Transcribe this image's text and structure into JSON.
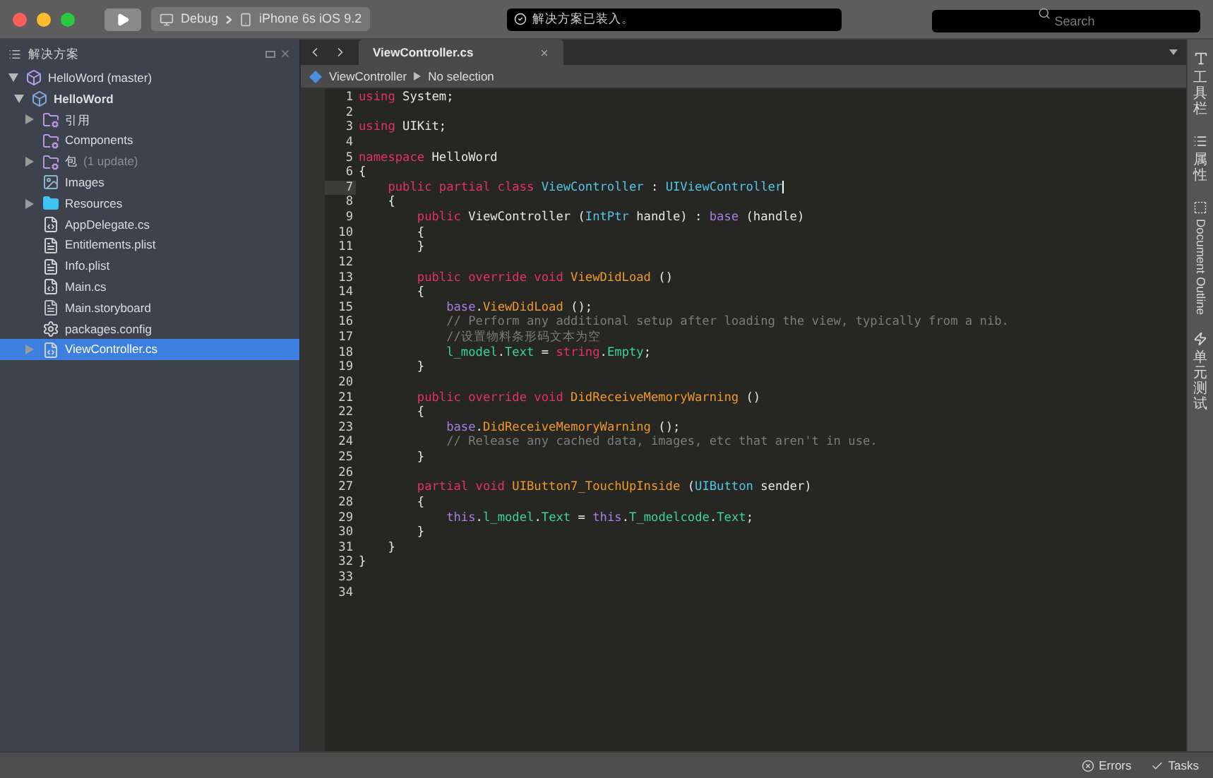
{
  "toolbar": {
    "config": "Debug",
    "device": "iPhone 6s iOS 9.2",
    "status": "解决方案已装入。",
    "search": {
      "placeholder": "Search"
    }
  },
  "solution_pad": {
    "title": "解决方案",
    "tree": [
      {
        "label": "HelloWord (master)",
        "kind": "solution",
        "expanded": true,
        "selected": false,
        "children": [
          {
            "label": "HelloWord",
            "kind": "project",
            "expanded": true,
            "selected": false,
            "children": [
              {
                "label": "引用",
                "kind": "folder-ref",
                "expanded": false,
                "selected": false
              },
              {
                "label": "Components",
                "kind": "folder-ref",
                "selected": false
              },
              {
                "label": "包",
                "note": "(1 update)",
                "kind": "folder-ref",
                "expanded": false,
                "selected": false
              },
              {
                "label": "Images",
                "kind": "folder-image",
                "selected": false
              },
              {
                "label": "Resources",
                "kind": "folder",
                "expanded": false,
                "selected": false
              },
              {
                "label": "AppDelegate.cs",
                "kind": "code",
                "selected": false
              },
              {
                "label": "Entitlements.plist",
                "kind": "file",
                "selected": false
              },
              {
                "label": "Info.plist",
                "kind": "file",
                "selected": false
              },
              {
                "label": "Main.cs",
                "kind": "code",
                "selected": false
              },
              {
                "label": "Main.storyboard",
                "kind": "storyboard",
                "selected": false
              },
              {
                "label": "packages.config",
                "kind": "config",
                "selected": false
              },
              {
                "label": "ViewController.cs",
                "kind": "code",
                "expanded": false,
                "selected": true
              }
            ]
          }
        ]
      }
    ]
  },
  "editor": {
    "tab": "ViewController.cs",
    "breadcrumb": [
      "ViewController",
      "No selection"
    ],
    "lines": [
      {
        "number": "1",
        "current": false,
        "tokens": [
          {
            "text": "using",
            "kind": "keyword"
          },
          {
            "text": " System;",
            "kind": "plain"
          }
        ]
      },
      {
        "number": "2",
        "current": false
      },
      {
        "number": "3",
        "current": false,
        "tokens": [
          {
            "text": "using",
            "kind": "keyword"
          },
          {
            "text": " UIKit;",
            "kind": "plain"
          }
        ]
      },
      {
        "number": "4",
        "current": false
      },
      {
        "number": "5",
        "current": false,
        "tokens": [
          {
            "text": "namespace",
            "kind": "keyword"
          },
          {
            "text": " HelloWord",
            "kind": "plain"
          }
        ]
      },
      {
        "number": "6",
        "current": false,
        "tokens": [
          {
            "text": "{",
            "kind": "plain"
          }
        ]
      },
      {
        "number": "7",
        "current": true,
        "tokens": [
          {
            "text": "    public partial class",
            "kind": "keyword"
          },
          {
            "text": " ViewController",
            "kind": "type"
          },
          {
            "text": " : ",
            "kind": "plain"
          },
          {
            "text": "UIViewController",
            "kind": "type"
          }
        ]
      },
      {
        "number": "8",
        "current": false,
        "tokens": [
          {
            "text": "    {",
            "kind": "plain"
          }
        ]
      },
      {
        "number": "9",
        "current": false,
        "tokens": [
          {
            "text": "        public",
            "kind": "keyword"
          },
          {
            "text": " ViewController (",
            "kind": "plain"
          },
          {
            "text": "IntPtr",
            "kind": "type"
          },
          {
            "text": " handle) : ",
            "kind": "plain"
          },
          {
            "text": "base",
            "kind": "self"
          },
          {
            "text": " (handle)",
            "kind": "plain"
          }
        ]
      },
      {
        "number": "10",
        "current": false,
        "tokens": [
          {
            "text": "        {",
            "kind": "plain"
          }
        ]
      },
      {
        "number": "11",
        "current": false,
        "tokens": [
          {
            "text": "        }",
            "kind": "plain"
          }
        ]
      },
      {
        "number": "12",
        "current": false
      },
      {
        "number": "13",
        "current": false,
        "tokens": [
          {
            "text": "        public override void",
            "kind": "keyword"
          },
          {
            "text": " ViewDidLoad",
            "kind": "method"
          },
          {
            "text": " ()",
            "kind": "plain"
          }
        ]
      },
      {
        "number": "14",
        "current": false,
        "tokens": [
          {
            "text": "        {",
            "kind": "plain"
          }
        ]
      },
      {
        "number": "15",
        "current": false,
        "tokens": [
          {
            "text": "            base",
            "kind": "self"
          },
          {
            "text": ".",
            "kind": "plain"
          },
          {
            "text": "ViewDidLoad",
            "kind": "method"
          },
          {
            "text": " ();",
            "kind": "plain"
          }
        ]
      },
      {
        "number": "16",
        "current": false,
        "tokens": [
          {
            "text": "            // Perform any additional setup after loading the view, typically from a nib.",
            "kind": "comment"
          }
        ]
      },
      {
        "number": "17",
        "current": false,
        "tokens": [
          {
            "text": "            //设置物料条形码文本为空",
            "kind": "comment"
          }
        ]
      },
      {
        "number": "18",
        "current": false,
        "tokens": [
          {
            "text": "            l_model",
            "kind": "property"
          },
          {
            "text": ".",
            "kind": "plain"
          },
          {
            "text": "Text",
            "kind": "property"
          },
          {
            "text": " = ",
            "kind": "plain"
          },
          {
            "text": "string",
            "kind": "keyword"
          },
          {
            "text": ".",
            "kind": "plain"
          },
          {
            "text": "Empty",
            "kind": "property"
          },
          {
            "text": ";",
            "kind": "plain"
          }
        ]
      },
      {
        "number": "19",
        "current": false,
        "tokens": [
          {
            "text": "        }",
            "kind": "plain"
          }
        ]
      },
      {
        "number": "20",
        "current": false
      },
      {
        "number": "21",
        "current": false,
        "tokens": [
          {
            "text": "        public override void",
            "kind": "keyword"
          },
          {
            "text": " DidReceiveMemoryWarning",
            "kind": "method"
          },
          {
            "text": " ()",
            "kind": "plain"
          }
        ]
      },
      {
        "number": "22",
        "current": false,
        "tokens": [
          {
            "text": "        {",
            "kind": "plain"
          }
        ]
      },
      {
        "number": "23",
        "current": false,
        "tokens": [
          {
            "text": "            base",
            "kind": "self"
          },
          {
            "text": ".",
            "kind": "plain"
          },
          {
            "text": "DidReceiveMemoryWarning",
            "kind": "method"
          },
          {
            "text": " ();",
            "kind": "plain"
          }
        ]
      },
      {
        "number": "24",
        "current": false,
        "tokens": [
          {
            "text": "            // Release any cached data, images, etc that aren't in use.",
            "kind": "comment"
          }
        ]
      },
      {
        "number": "25",
        "current": false,
        "tokens": [
          {
            "text": "        }",
            "kind": "plain"
          }
        ]
      },
      {
        "number": "26",
        "current": false
      },
      {
        "number": "27",
        "current": false,
        "tokens": [
          {
            "text": "        partial void",
            "kind": "keyword"
          },
          {
            "text": " UIButton7_TouchUpInside",
            "kind": "method"
          },
          {
            "text": " (",
            "kind": "plain"
          },
          {
            "text": "UIButton",
            "kind": "type"
          },
          {
            "text": " sender)",
            "kind": "plain"
          }
        ]
      },
      {
        "number": "28",
        "current": false,
        "tokens": [
          {
            "text": "        {",
            "kind": "plain"
          }
        ]
      },
      {
        "number": "29",
        "current": false,
        "tokens": [
          {
            "text": "            this",
            "kind": "self"
          },
          {
            "text": ".",
            "kind": "plain"
          },
          {
            "text": "l_model",
            "kind": "property"
          },
          {
            "text": ".",
            "kind": "plain"
          },
          {
            "text": "Text",
            "kind": "property"
          },
          {
            "text": " = ",
            "kind": "plain"
          },
          {
            "text": "this",
            "kind": "self"
          },
          {
            "text": ".",
            "kind": "plain"
          },
          {
            "text": "T_modelcode",
            "kind": "property"
          },
          {
            "text": ".",
            "kind": "plain"
          },
          {
            "text": "Text",
            "kind": "property"
          },
          {
            "text": ";",
            "kind": "plain"
          }
        ]
      },
      {
        "number": "30",
        "current": false,
        "tokens": [
          {
            "text": "        }",
            "kind": "plain"
          }
        ]
      },
      {
        "number": "31",
        "current": false,
        "tokens": [
          {
            "text": "    }",
            "kind": "plain"
          }
        ]
      },
      {
        "number": "32",
        "current": false,
        "tokens": [
          {
            "text": "}",
            "kind": "plain"
          }
        ]
      },
      {
        "number": "33",
        "current": false
      },
      {
        "number": "34",
        "current": false
      }
    ]
  },
  "right_pads": [
    {
      "label": "工具栏",
      "kind": "cjk"
    },
    {
      "label": "属性",
      "kind": "cjk"
    },
    {
      "label": "Document Outline",
      "kind": "latin"
    },
    {
      "label": "单元测试",
      "kind": "cjk"
    }
  ],
  "status_bar": [
    {
      "label": "Errors"
    },
    {
      "label": "Tasks"
    }
  ]
}
